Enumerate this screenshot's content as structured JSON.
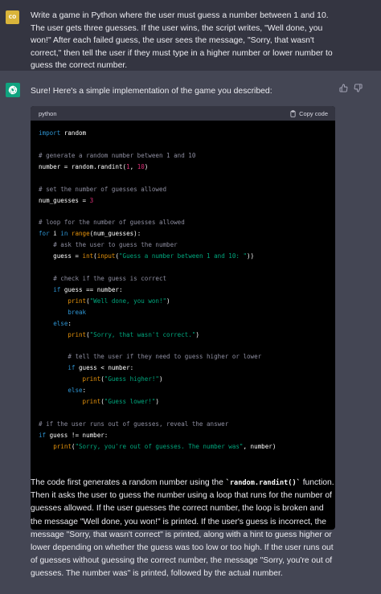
{
  "user_message": {
    "avatar_initials": "CO",
    "text": "Write a game in Python where the user must guess a number between 1 and 10. The user gets three guesses. If the user wins, the script writes, \"Well done, you won!\" After each failed guess, the user sees the message, \"Sorry, that wasn't correct,\" then tell the user if they must type in a higher number or lower number to guess the correct number."
  },
  "assistant_message": {
    "avatar_icon": "openai-logo-icon",
    "intro": "Sure! Here's a simple implementation of the game you described:",
    "code_block": {
      "language": "python",
      "copy_label": "Copy code"
    },
    "description_parts": [
      "The code first generates a random number using the ",
      "`random.randint()`",
      " function. Then it asks the user to guess the number using a loop that runs for the number of guesses allowed. If the user guesses the correct number, the loop is broken and the message \"Well done, you won!\" is printed. If the user's guess is incorrect, the message \"Sorry, that wasn't correct\" is printed, along with a hint to guess higher or lower depending on whether the guess was too low or too high. If the user runs out of guesses without guessing the correct number, the message \"Sorry, you're out of guesses. The number was\" is printed, followed by the actual number."
    ]
  },
  "code_lines": [
    [
      {
        "t": "import",
        "c": "kw"
      },
      {
        "t": " random",
        "c": ""
      }
    ],
    [],
    [
      {
        "t": "# generate a random number between 1 and 10",
        "c": "cmt"
      }
    ],
    [
      {
        "t": "number = random.randint(",
        "c": ""
      },
      {
        "t": "1",
        "c": "num"
      },
      {
        "t": ", ",
        "c": ""
      },
      {
        "t": "10",
        "c": "num"
      },
      {
        "t": ")",
        "c": ""
      }
    ],
    [],
    [
      {
        "t": "# set the number of guesses allowed",
        "c": "cmt"
      }
    ],
    [
      {
        "t": "num_guesses = ",
        "c": ""
      },
      {
        "t": "3",
        "c": "num"
      }
    ],
    [],
    [
      {
        "t": "# loop for the number of guesses allowed",
        "c": "cmt"
      }
    ],
    [
      {
        "t": "for",
        "c": "kw"
      },
      {
        "t": " i ",
        "c": ""
      },
      {
        "t": "in",
        "c": "kw"
      },
      {
        "t": " ",
        "c": ""
      },
      {
        "t": "range",
        "c": "builtin"
      },
      {
        "t": "(num_guesses):",
        "c": ""
      }
    ],
    [
      {
        "t": "    ",
        "c": ""
      },
      {
        "t": "# ask the user to guess the number",
        "c": "cmt"
      }
    ],
    [
      {
        "t": "    guess = ",
        "c": ""
      },
      {
        "t": "int",
        "c": "builtin"
      },
      {
        "t": "(",
        "c": ""
      },
      {
        "t": "input",
        "c": "builtin"
      },
      {
        "t": "(",
        "c": ""
      },
      {
        "t": "\"Guess a number between 1 and 10: \"",
        "c": "str"
      },
      {
        "t": "))",
        "c": ""
      }
    ],
    [],
    [
      {
        "t": "    ",
        "c": ""
      },
      {
        "t": "# check if the guess is correct",
        "c": "cmt"
      }
    ],
    [
      {
        "t": "    ",
        "c": ""
      },
      {
        "t": "if",
        "c": "kw"
      },
      {
        "t": " guess == number:",
        "c": ""
      }
    ],
    [
      {
        "t": "        ",
        "c": ""
      },
      {
        "t": "print",
        "c": "builtin"
      },
      {
        "t": "(",
        "c": ""
      },
      {
        "t": "\"Well done, you won!\"",
        "c": "str"
      },
      {
        "t": ")",
        "c": ""
      }
    ],
    [
      {
        "t": "        ",
        "c": ""
      },
      {
        "t": "break",
        "c": "kw"
      }
    ],
    [
      {
        "t": "    ",
        "c": ""
      },
      {
        "t": "else",
        "c": "kw"
      },
      {
        "t": ":",
        "c": ""
      }
    ],
    [
      {
        "t": "        ",
        "c": ""
      },
      {
        "t": "print",
        "c": "builtin"
      },
      {
        "t": "(",
        "c": ""
      },
      {
        "t": "\"Sorry, that wasn't correct.\"",
        "c": "str"
      },
      {
        "t": ")",
        "c": ""
      }
    ],
    [],
    [
      {
        "t": "        ",
        "c": ""
      },
      {
        "t": "# tell the user if they need to guess higher or lower",
        "c": "cmt"
      }
    ],
    [
      {
        "t": "        ",
        "c": ""
      },
      {
        "t": "if",
        "c": "kw"
      },
      {
        "t": " guess < number:",
        "c": ""
      }
    ],
    [
      {
        "t": "            ",
        "c": ""
      },
      {
        "t": "print",
        "c": "builtin"
      },
      {
        "t": "(",
        "c": ""
      },
      {
        "t": "\"Guess higher!\"",
        "c": "str"
      },
      {
        "t": ")",
        "c": ""
      }
    ],
    [
      {
        "t": "        ",
        "c": ""
      },
      {
        "t": "else",
        "c": "kw"
      },
      {
        "t": ":",
        "c": ""
      }
    ],
    [
      {
        "t": "            ",
        "c": ""
      },
      {
        "t": "print",
        "c": "builtin"
      },
      {
        "t": "(",
        "c": ""
      },
      {
        "t": "\"Guess lower!\"",
        "c": "str"
      },
      {
        "t": ")",
        "c": ""
      }
    ],
    [],
    [
      {
        "t": "# if the user runs out of guesses, reveal the answer",
        "c": "cmt"
      }
    ],
    [
      {
        "t": "if",
        "c": "kw"
      },
      {
        "t": " guess != number:",
        "c": ""
      }
    ],
    [
      {
        "t": "    ",
        "c": ""
      },
      {
        "t": "print",
        "c": "builtin"
      },
      {
        "t": "(",
        "c": ""
      },
      {
        "t": "\"Sorry, you're out of guesses. The number was\"",
        "c": "str"
      },
      {
        "t": ", number)",
        "c": ""
      }
    ]
  ],
  "feedback": [
    {
      "icon": "thumbs-up-icon"
    },
    {
      "icon": "thumbs-down-icon"
    }
  ],
  "colors": {
    "user_bg": "#343541",
    "assistant_bg": "#444654",
    "user_avatar": "#d9b43a",
    "assistant_avatar": "#10a37f",
    "code_bg": "#000000",
    "code_header_bg": "#343541"
  }
}
